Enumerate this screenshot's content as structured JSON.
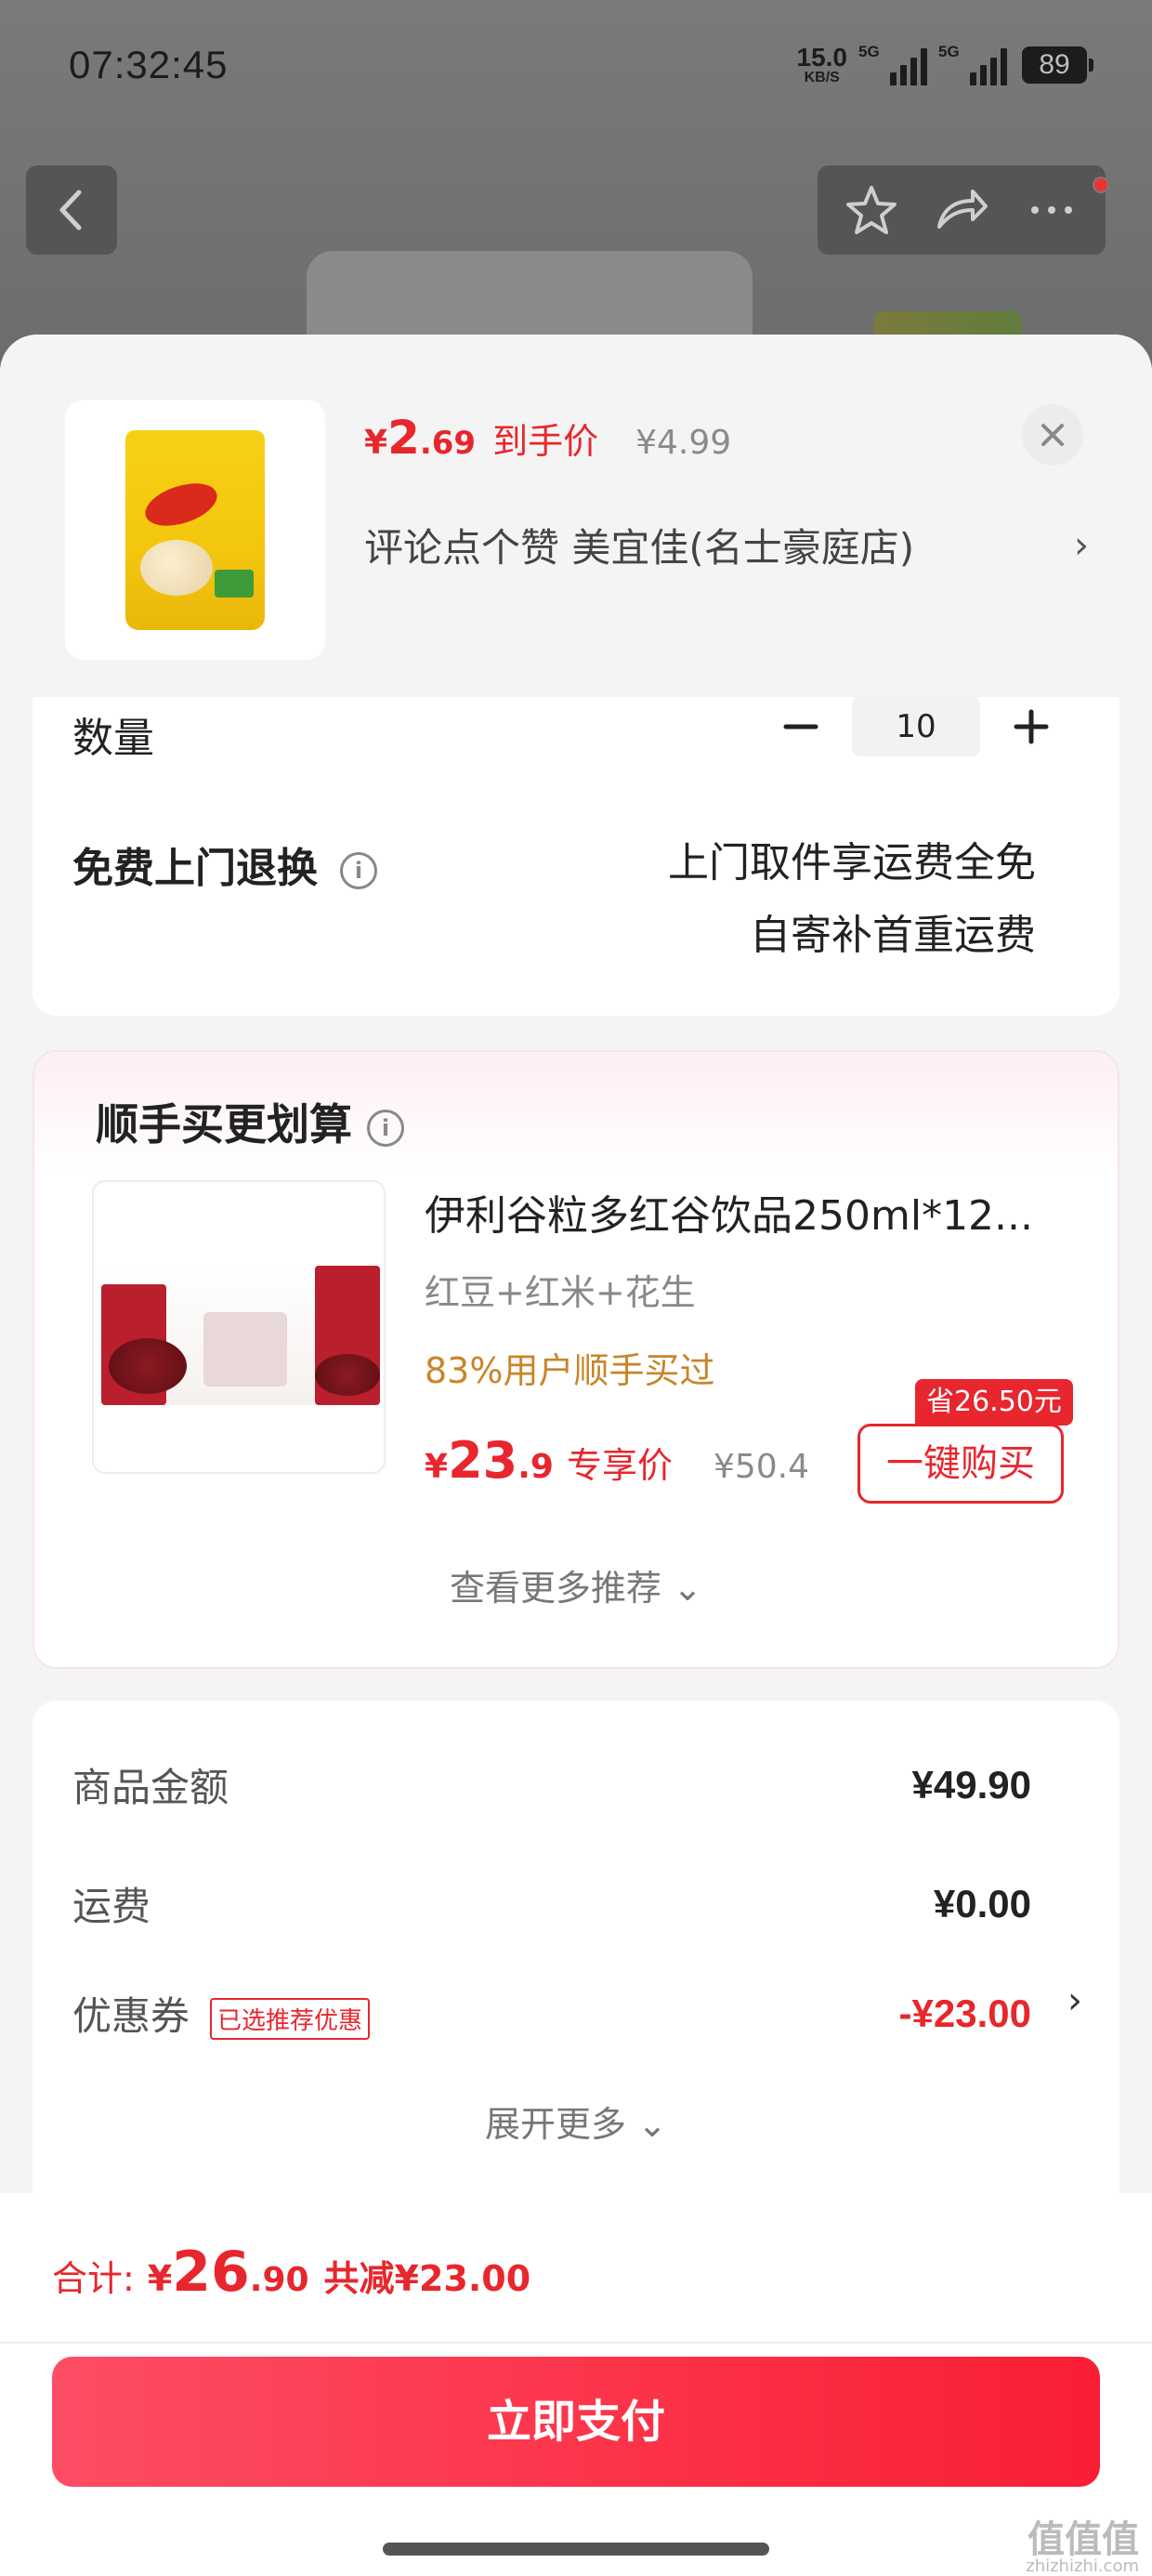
{
  "status_bar": {
    "time": "07:32:45",
    "net_speed": "15.0",
    "net_unit": "KB/S",
    "signal1_label": "5G",
    "signal2_label": "5G",
    "battery": "89"
  },
  "nav": {
    "back_icon": "chevron-left-icon",
    "actions": [
      "star-icon",
      "share-icon",
      "more-icon"
    ]
  },
  "product": {
    "price_symbol": "¥",
    "price_int": "2",
    "price_dec": ".69",
    "price_tag": "到手价",
    "original_price": "¥4.99",
    "store_text": "评论点个赞  美宜佳(名士豪庭店)",
    "store_chevron": "›"
  },
  "quantity": {
    "label": "数量",
    "minus": "−",
    "value": "10",
    "plus": "+"
  },
  "returns": {
    "label": "免费上门退换",
    "info": "i",
    "line1": "上门取件享运费全免",
    "line2": "自寄补首重运费"
  },
  "recommend": {
    "title": "顺手买更划算",
    "info": "i",
    "item_name": "伊利谷粒多红谷饮品250ml*12...",
    "item_sub": "红豆+红米+花生",
    "item_stat": "83%用户顺手买过",
    "price_symbol": "¥",
    "price_int": "23",
    "price_dec": ".9",
    "price_tag": "专享价",
    "original_price": "¥50.4",
    "save_badge": "省26.50元",
    "buy_button": "一键购买",
    "more": "查看更多推荐 ⌄"
  },
  "summary": {
    "goods_label": "商品金额",
    "goods_value": "¥49.90",
    "shipping_label": "运费",
    "shipping_value": "¥0.00",
    "coupon_label": "优惠券",
    "coupon_tag": "已选推荐优惠",
    "coupon_value": "-¥23.00",
    "coupon_chevron": "›",
    "expand": "展开更多 ⌄"
  },
  "footer": {
    "total_label": "合计:",
    "total_symbol": "¥",
    "total_int": "26",
    "total_dec": ".90",
    "saved": "共减¥23.00",
    "pay_button": "立即支付"
  },
  "watermark": {
    "text": "值值值",
    "sub": "zhizhizhi.com"
  }
}
